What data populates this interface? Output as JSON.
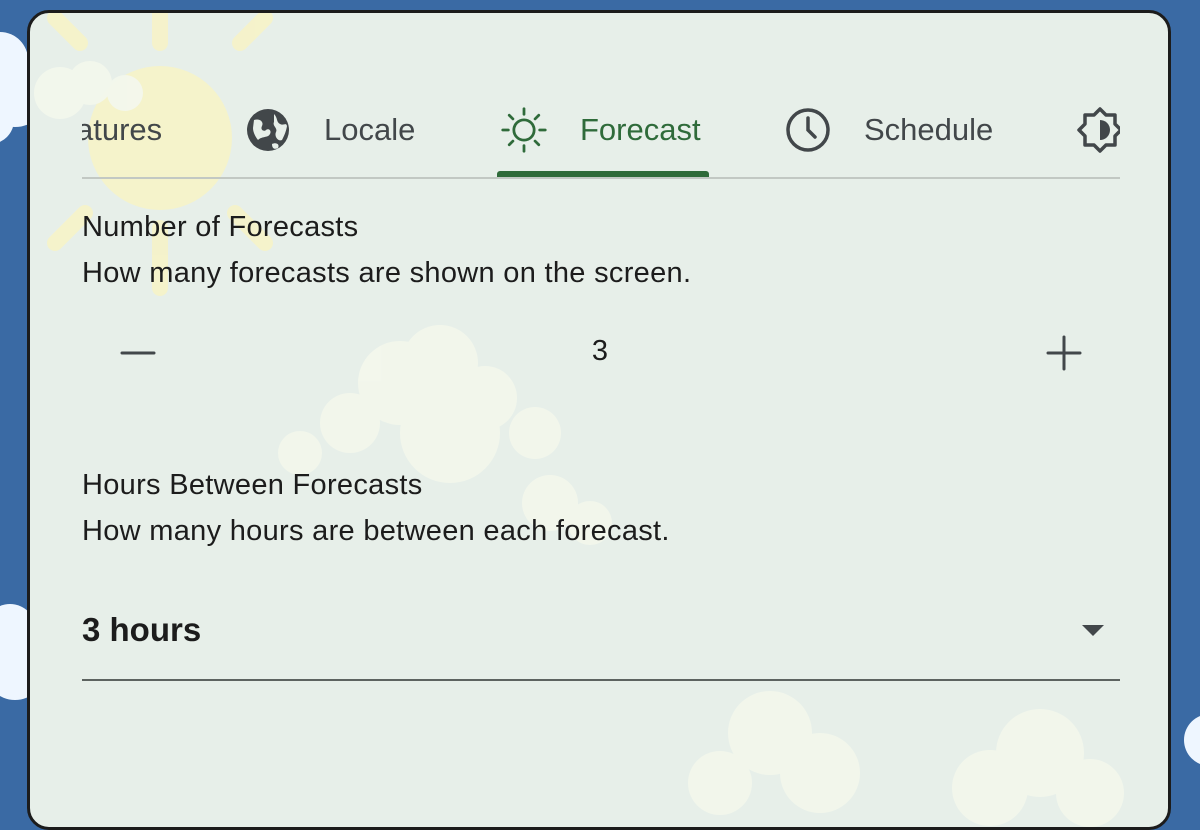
{
  "tabs": [
    {
      "label": "atures",
      "icon": "features-icon",
      "active": false
    },
    {
      "label": "Locale",
      "icon": "globe-icon",
      "active": false
    },
    {
      "label": "Forecast",
      "icon": "sun-icon",
      "active": true
    },
    {
      "label": "Schedule",
      "icon": "clock-icon",
      "active": false
    },
    {
      "label": "",
      "icon": "brightness-icon",
      "active": false
    }
  ],
  "forecast_count": {
    "title": "Number of Forecasts",
    "description": "How many forecasts are shown on the screen.",
    "value": "3",
    "decrement_icon": "minus-icon",
    "increment_icon": "plus-icon"
  },
  "forecast_interval": {
    "title": "Hours Between Forecasts",
    "description": "How many hours are between each forecast.",
    "selected": "3 hours",
    "dropdown_icon": "chevron-down-icon"
  },
  "colors": {
    "accent": "#2f6b3a",
    "panel_background": "#e7efe9",
    "page_background": "#3a6aa4",
    "text": "#1c1c1c"
  }
}
